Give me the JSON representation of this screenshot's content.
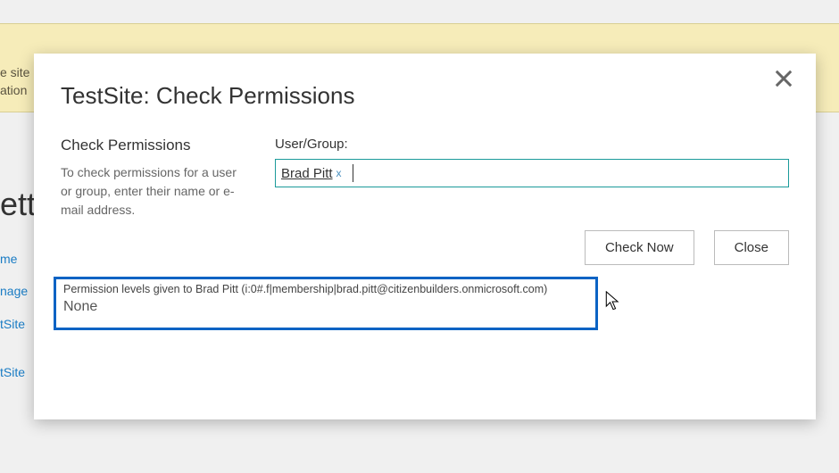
{
  "background": {
    "partial_text_1": "e site",
    "partial_text_2": "ation",
    "big_title_fragment": "ett",
    "nav_1": "me",
    "nav_2": "nage",
    "nav_3": "tSite",
    "nav_4": "tSite"
  },
  "dialog": {
    "title": "TestSite: Check Permissions",
    "section_heading": "Check Permissions",
    "section_desc": "To check permissions for a user or group, enter their name or e-mail address.",
    "field_label": "User/Group:",
    "chip_name": "Brad Pitt",
    "chip_remove": "x",
    "btn_check": "Check Now",
    "btn_close": "Close",
    "results_heading": "Permission levels given to Brad Pitt (i:0#.f|membership|brad.pitt@citizenbuilders.onmicrosoft.com)",
    "results_value": "None"
  }
}
